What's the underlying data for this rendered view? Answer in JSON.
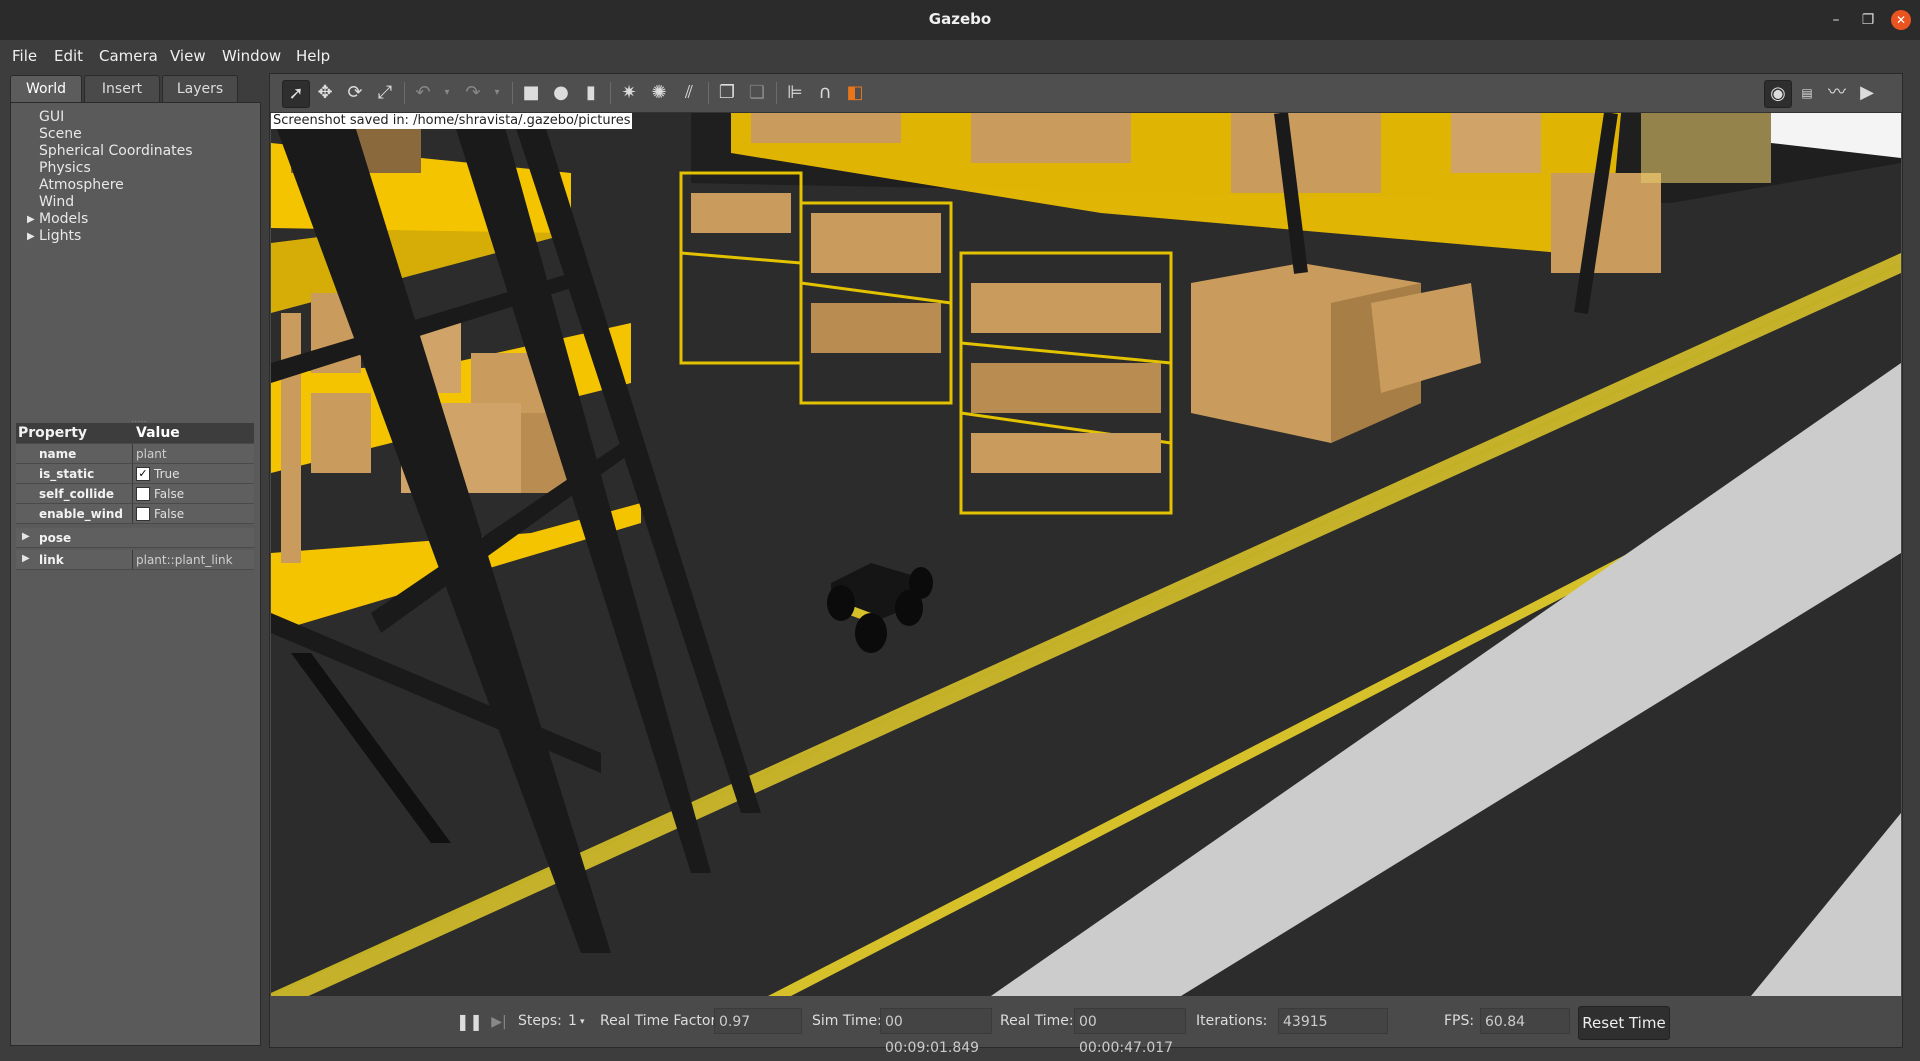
{
  "window": {
    "title": "Gazebo"
  },
  "menu": [
    "File",
    "Edit",
    "Camera",
    "View",
    "Window",
    "Help"
  ],
  "left_tabs": [
    "World",
    "Insert",
    "Layers"
  ],
  "world_tree": [
    "GUI",
    "Scene",
    "Spherical Coordinates",
    "Physics",
    "Atmosphere",
    "Wind",
    "Models",
    "Lights"
  ],
  "properties": {
    "header": {
      "property": "Property",
      "value": "Value"
    },
    "rows": [
      {
        "key": "name",
        "value": "plant"
      },
      {
        "key": "is_static",
        "value": "True",
        "checked": true
      },
      {
        "key": "self_collide",
        "value": "False",
        "checked": false
      },
      {
        "key": "enable_wind",
        "value": "False",
        "checked": false
      },
      {
        "key": "pose",
        "value": ""
      },
      {
        "key": "link",
        "value": "plant::plant_link"
      }
    ]
  },
  "viewport": {
    "notice": "Screenshot saved in: /home/shravista/.gazebo/pictures"
  },
  "statusbar": {
    "steps_label": "Steps:",
    "steps_value": "1",
    "rtf_label": "Real Time Factor:",
    "rtf_value": "0.97",
    "sim_label": "Sim Time:",
    "sim_value": "00 00:09:01.849",
    "real_label": "Real Time:",
    "real_value": "00 00:00:47.017",
    "iter_label": "Iterations:",
    "iter_value": "43915",
    "fps_label": "FPS:",
    "fps_value": "60.84",
    "reset_label": "Reset Time"
  },
  "colors": {
    "accent": "#e95420",
    "shelf_yellow": "#f5c400",
    "floor": "#2b2b2b",
    "box": "#c99b5c"
  }
}
